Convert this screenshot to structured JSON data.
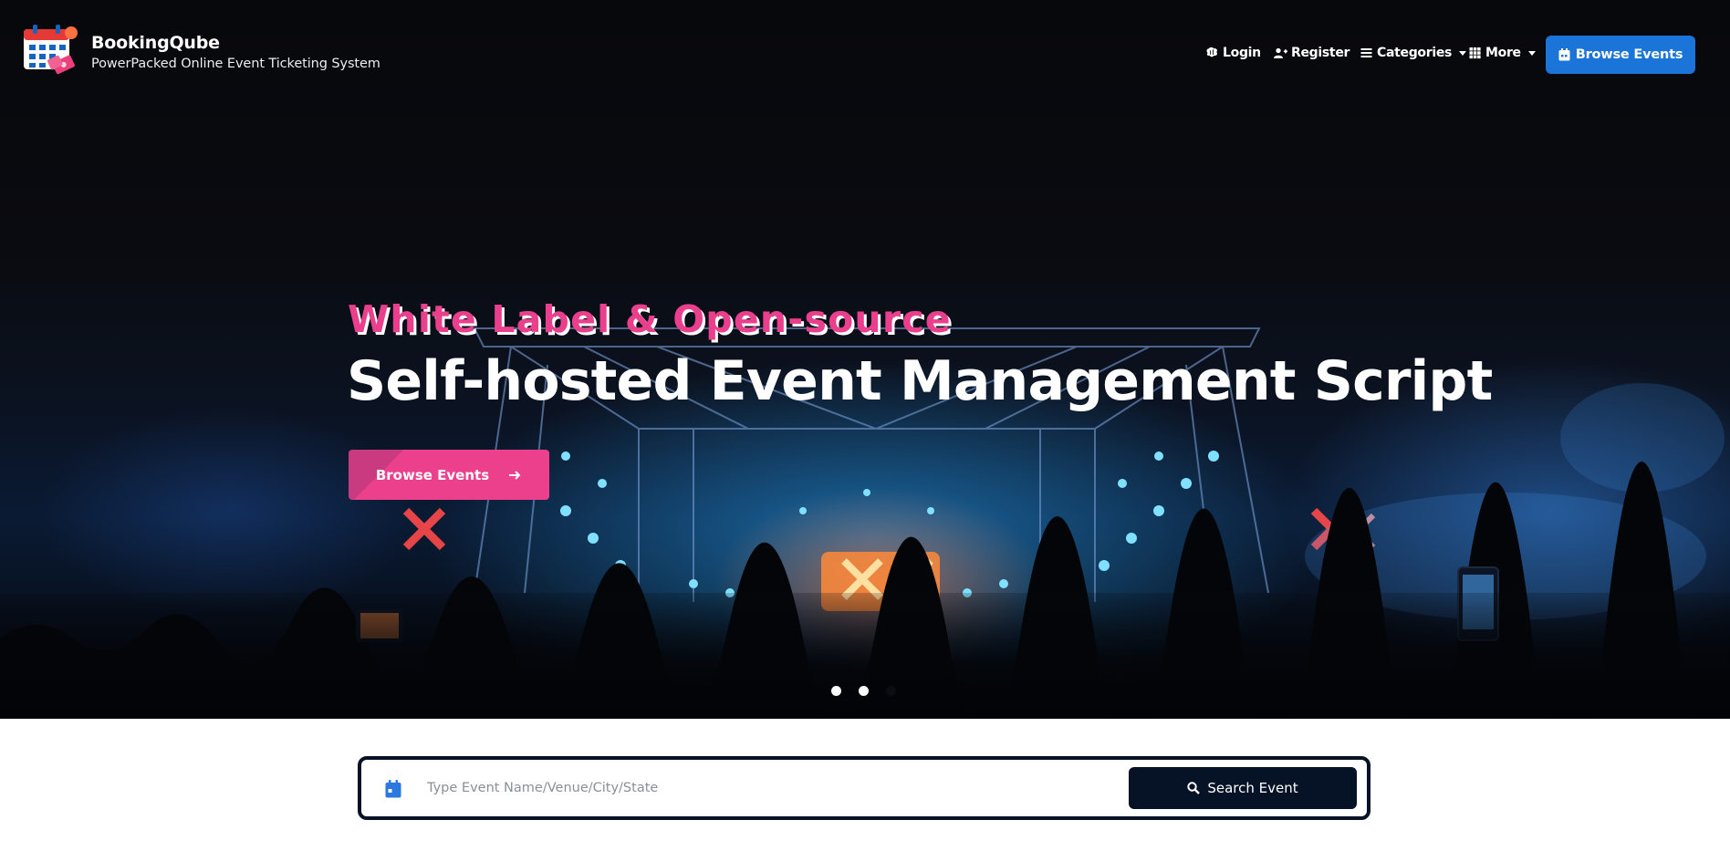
{
  "brand": {
    "name": "BookingQube",
    "tagline": "PowerPacked Online Event Ticketing System",
    "logo_icon": "calendar-ticket-logo"
  },
  "nav": {
    "items": [
      {
        "label": "Login",
        "icon": "brain-icon"
      },
      {
        "label": "Register",
        "icon": "user-plus-icon"
      },
      {
        "label": "Categories",
        "icon": "list-icon",
        "dropdown": true
      },
      {
        "label": "More",
        "icon": "grid-icon",
        "dropdown": true
      }
    ],
    "cta": {
      "label": "Browse Events",
      "icon": "calendar-icon",
      "color": "#1b74d8"
    }
  },
  "hero": {
    "subtitle": "White Label & Open-source",
    "title": "Self-hosted Event Management Script",
    "button": {
      "label": "Browse Events",
      "icon": "arrow-right-icon",
      "color": "#ec3f8c"
    },
    "slides": {
      "count": 3,
      "active": 3
    }
  },
  "search": {
    "placeholder": "Type Event Name/Venue/City/State",
    "value": "",
    "button_label": "Search Event",
    "button_icon": "search-icon",
    "button_color": "#061326",
    "field_icon": "calendar-icon"
  },
  "colors": {
    "accent_pink": "#ea3f8c",
    "accent_blue": "#1b74d8",
    "navy": "#061326"
  }
}
